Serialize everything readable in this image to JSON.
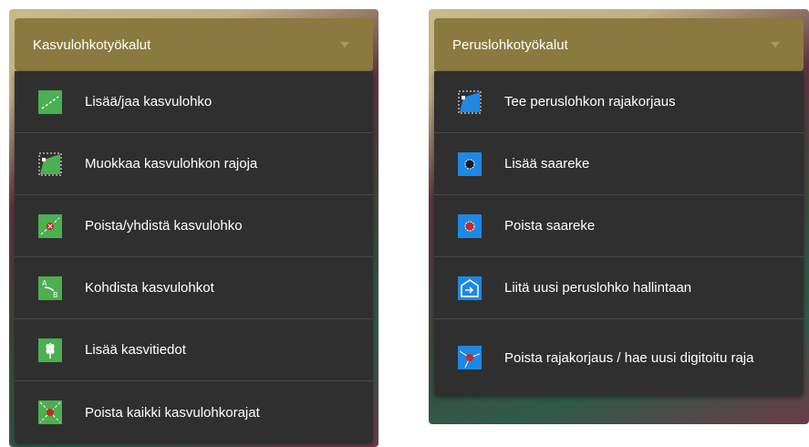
{
  "left_panel": {
    "title": "Kasvulohkotyökalut",
    "items": [
      {
        "label": "Lisää/jaa kasvulohko",
        "icon": "split-parcel-icon"
      },
      {
        "label": "Muokkaa kasvulohkon rajoja",
        "icon": "edit-boundary-icon"
      },
      {
        "label": "Poista/yhdistä kasvulohko",
        "icon": "delete-merge-parcel-icon"
      },
      {
        "label": "Kohdista kasvulohkot",
        "icon": "align-parcels-icon"
      },
      {
        "label": "Lisää kasvitiedot",
        "icon": "crop-info-icon"
      },
      {
        "label": "Poista kaikki kasvulohkorajat",
        "icon": "delete-all-boundaries-icon"
      }
    ]
  },
  "right_panel": {
    "title": "Peruslohkotyökalut",
    "items": [
      {
        "label": "Tee peruslohkon rajakorjaus",
        "icon": "boundary-correction-icon"
      },
      {
        "label": "Lisää saareke",
        "icon": "add-island-icon"
      },
      {
        "label": "Poista saareke",
        "icon": "remove-island-icon"
      },
      {
        "label": "Liitä uusi peruslohko hallintaan",
        "icon": "attach-parcel-icon"
      },
      {
        "label": "Poista rajakorjaus / hae uusi digitoitu raja",
        "icon": "remove-correction-icon"
      }
    ]
  },
  "colors": {
    "header": "#8b7a3f",
    "menu_bg": "#2f2f2f",
    "green_icon": "#4caf50",
    "blue_icon": "#1e88e5"
  }
}
